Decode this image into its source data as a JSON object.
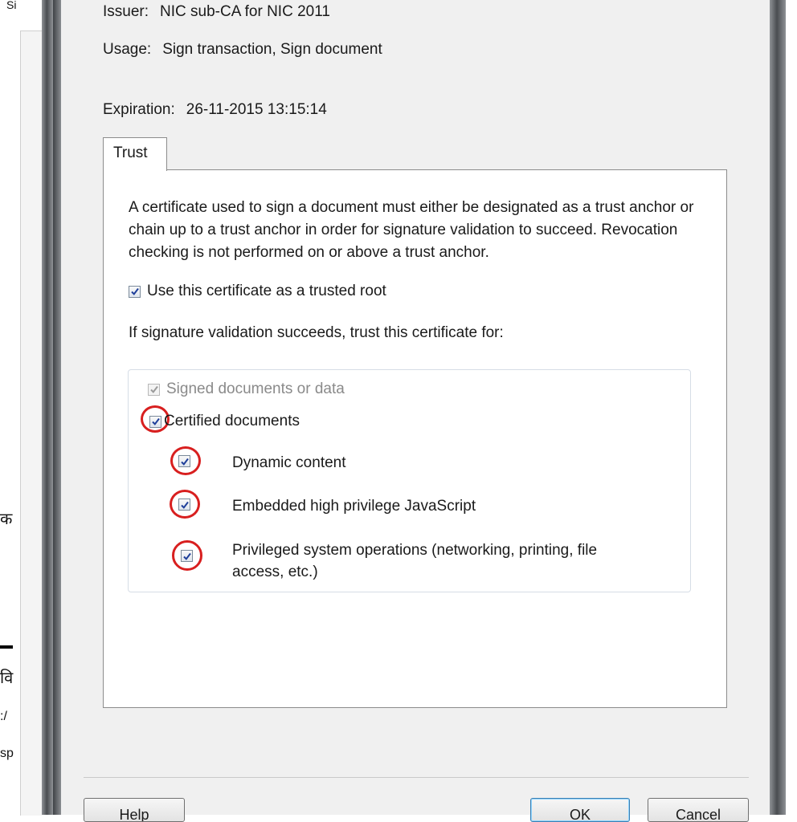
{
  "background_fragments": {
    "top_left": "Si",
    "mid_1": "क",
    "mid_2": "वि",
    "mid_3": ":/",
    "mid_4": "sp"
  },
  "certificate": {
    "issuer_label": "Issuer:",
    "issuer_value": "NIC sub-CA for NIC 2011",
    "usage_label": "Usage:",
    "usage_value": "Sign transaction, Sign document",
    "expiration_label": "Expiration:",
    "expiration_value": "26-11-2015 13:15:14"
  },
  "tabs": [
    {
      "label": "Trust",
      "selected": true
    }
  ],
  "trust": {
    "description": "A certificate used to sign a document must either be designated as a trust anchor or chain up to a trust anchor in order for signature validation to succeed.  Revocation checking is not performed on or above a trust anchor.",
    "trusted_root_label": "Use this certificate as a trusted root",
    "trusted_root_checked": true,
    "trust_for_label": "If signature validation succeeds, trust this certificate for:",
    "options": [
      {
        "label": "Signed documents or data",
        "checked": true,
        "disabled": true
      },
      {
        "label": "Certified documents",
        "checked": true,
        "disabled": false
      },
      {
        "label": "Dynamic content",
        "checked": true,
        "disabled": false
      },
      {
        "label": "Embedded high privilege JavaScript",
        "checked": true,
        "disabled": false
      },
      {
        "label": "Privileged system operations (networking, printing, file access, etc.)",
        "checked": true,
        "disabled": false
      }
    ]
  },
  "buttons": {
    "help": "Help",
    "ok": "OK",
    "cancel": "Cancel"
  },
  "colors": {
    "highlight_ring": "#d81f1f",
    "checkmark": "#1f3f9a",
    "dialog_background": "#f0f0f0"
  }
}
